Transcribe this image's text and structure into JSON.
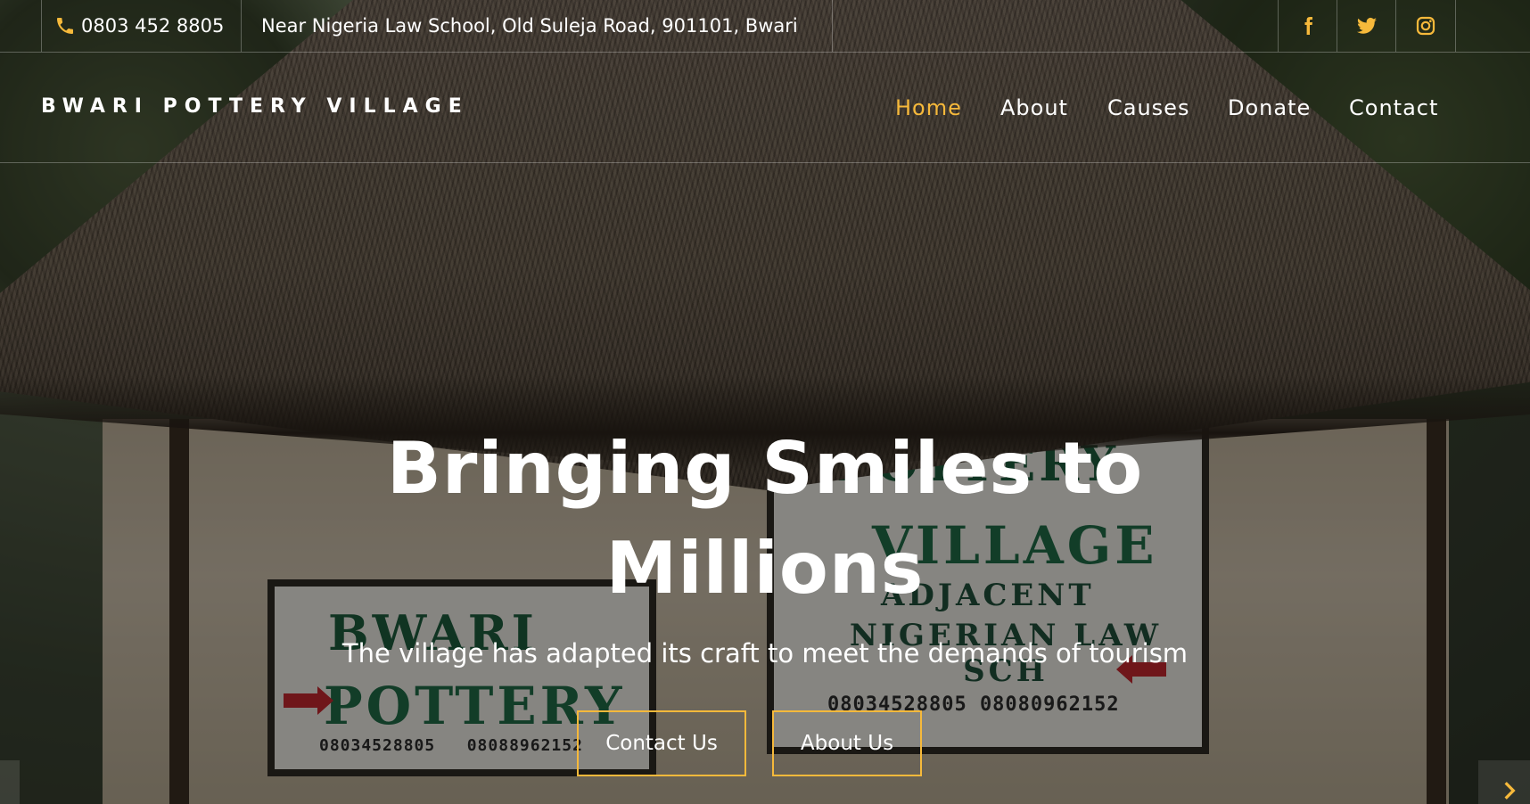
{
  "topbar": {
    "phone": "0803 452 8805",
    "address": "Near Nigeria Law School, Old Suleja Road, 901101, Bwari",
    "social": [
      "facebook-icon",
      "twitter-icon",
      "instagram-icon"
    ]
  },
  "brand": "BWARI POTTERY VILLAGE",
  "nav": {
    "items": [
      {
        "label": "Home",
        "active": true
      },
      {
        "label": "About",
        "active": false
      },
      {
        "label": "Causes",
        "active": false
      },
      {
        "label": "Donate",
        "active": false
      },
      {
        "label": "Contact",
        "active": false
      }
    ]
  },
  "hero": {
    "title_line1": "Bringing Smiles to",
    "title_line2": "Millions",
    "subtitle": "The village has adapted its craft to meet the demands of tourism",
    "buttons": {
      "contact": "Contact Us",
      "about": "About Us"
    }
  },
  "colors": {
    "accent": "#f6b93b",
    "text": "#ffffff",
    "overlay": "rgba(0,0,0,0.42)"
  }
}
